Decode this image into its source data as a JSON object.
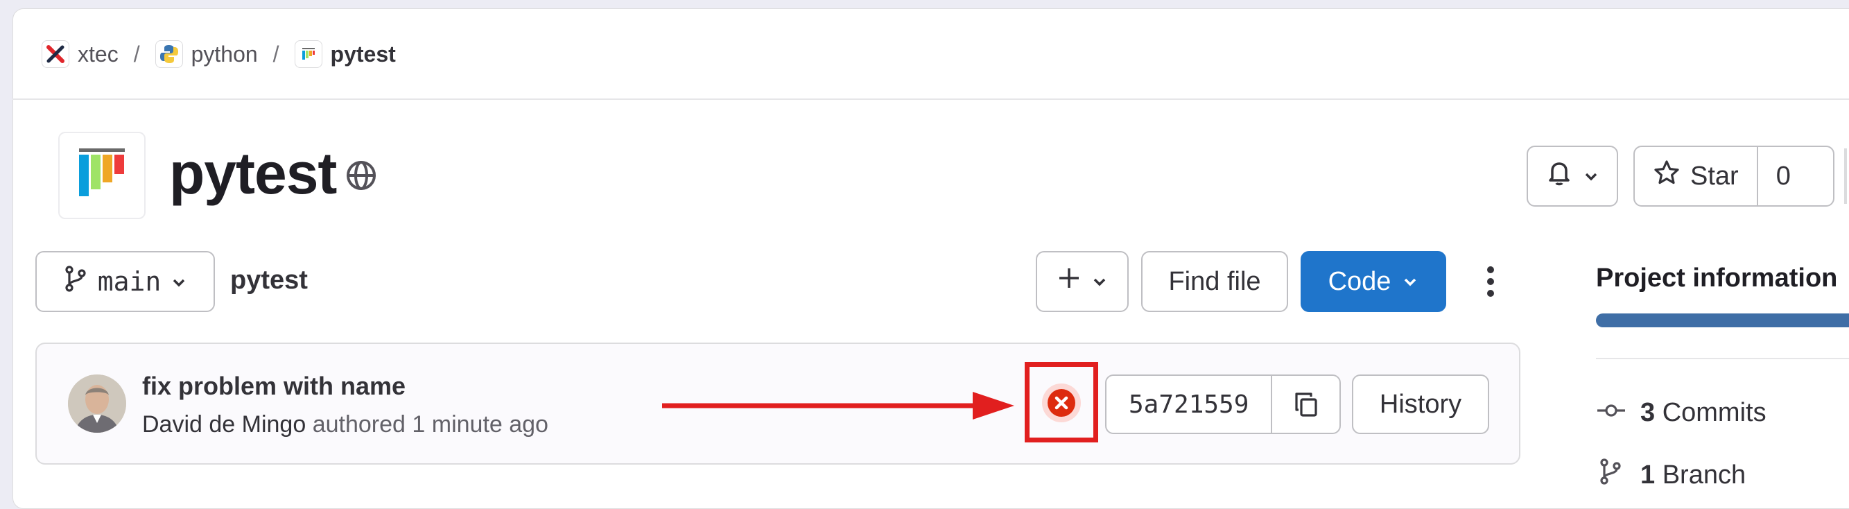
{
  "breadcrumb": [
    {
      "label": "xtec",
      "icon": "xtec-logo-icon"
    },
    {
      "label": "python",
      "icon": "python-logo-icon"
    },
    {
      "label": "pytest",
      "icon": "pytest-logo-icon"
    }
  ],
  "breadcrumb_separator": "/",
  "project": {
    "title": "pytest",
    "visibility_icon": "globe-icon"
  },
  "actions": {
    "star_label": "Star",
    "star_count": "0"
  },
  "branch_row": {
    "branch": "main",
    "path": "pytest",
    "find_file_label": "Find file",
    "code_label": "Code"
  },
  "commit": {
    "title": "fix problem with name",
    "author": "David de Mingo",
    "authored_text": "authored",
    "time": "1 minute ago",
    "sha": "5a721559",
    "history_label": "History",
    "status": "failed"
  },
  "sidebar": {
    "title": "Project information",
    "stats": [
      {
        "count": "3",
        "label": "Commits",
        "icon": "commit-icon"
      },
      {
        "count": "1",
        "label": "Branch",
        "icon": "branch-icon"
      }
    ]
  },
  "colors": {
    "primary": "#1f75cb",
    "annotation_red": "#e11f1f",
    "failed": "#dd2b0e"
  }
}
